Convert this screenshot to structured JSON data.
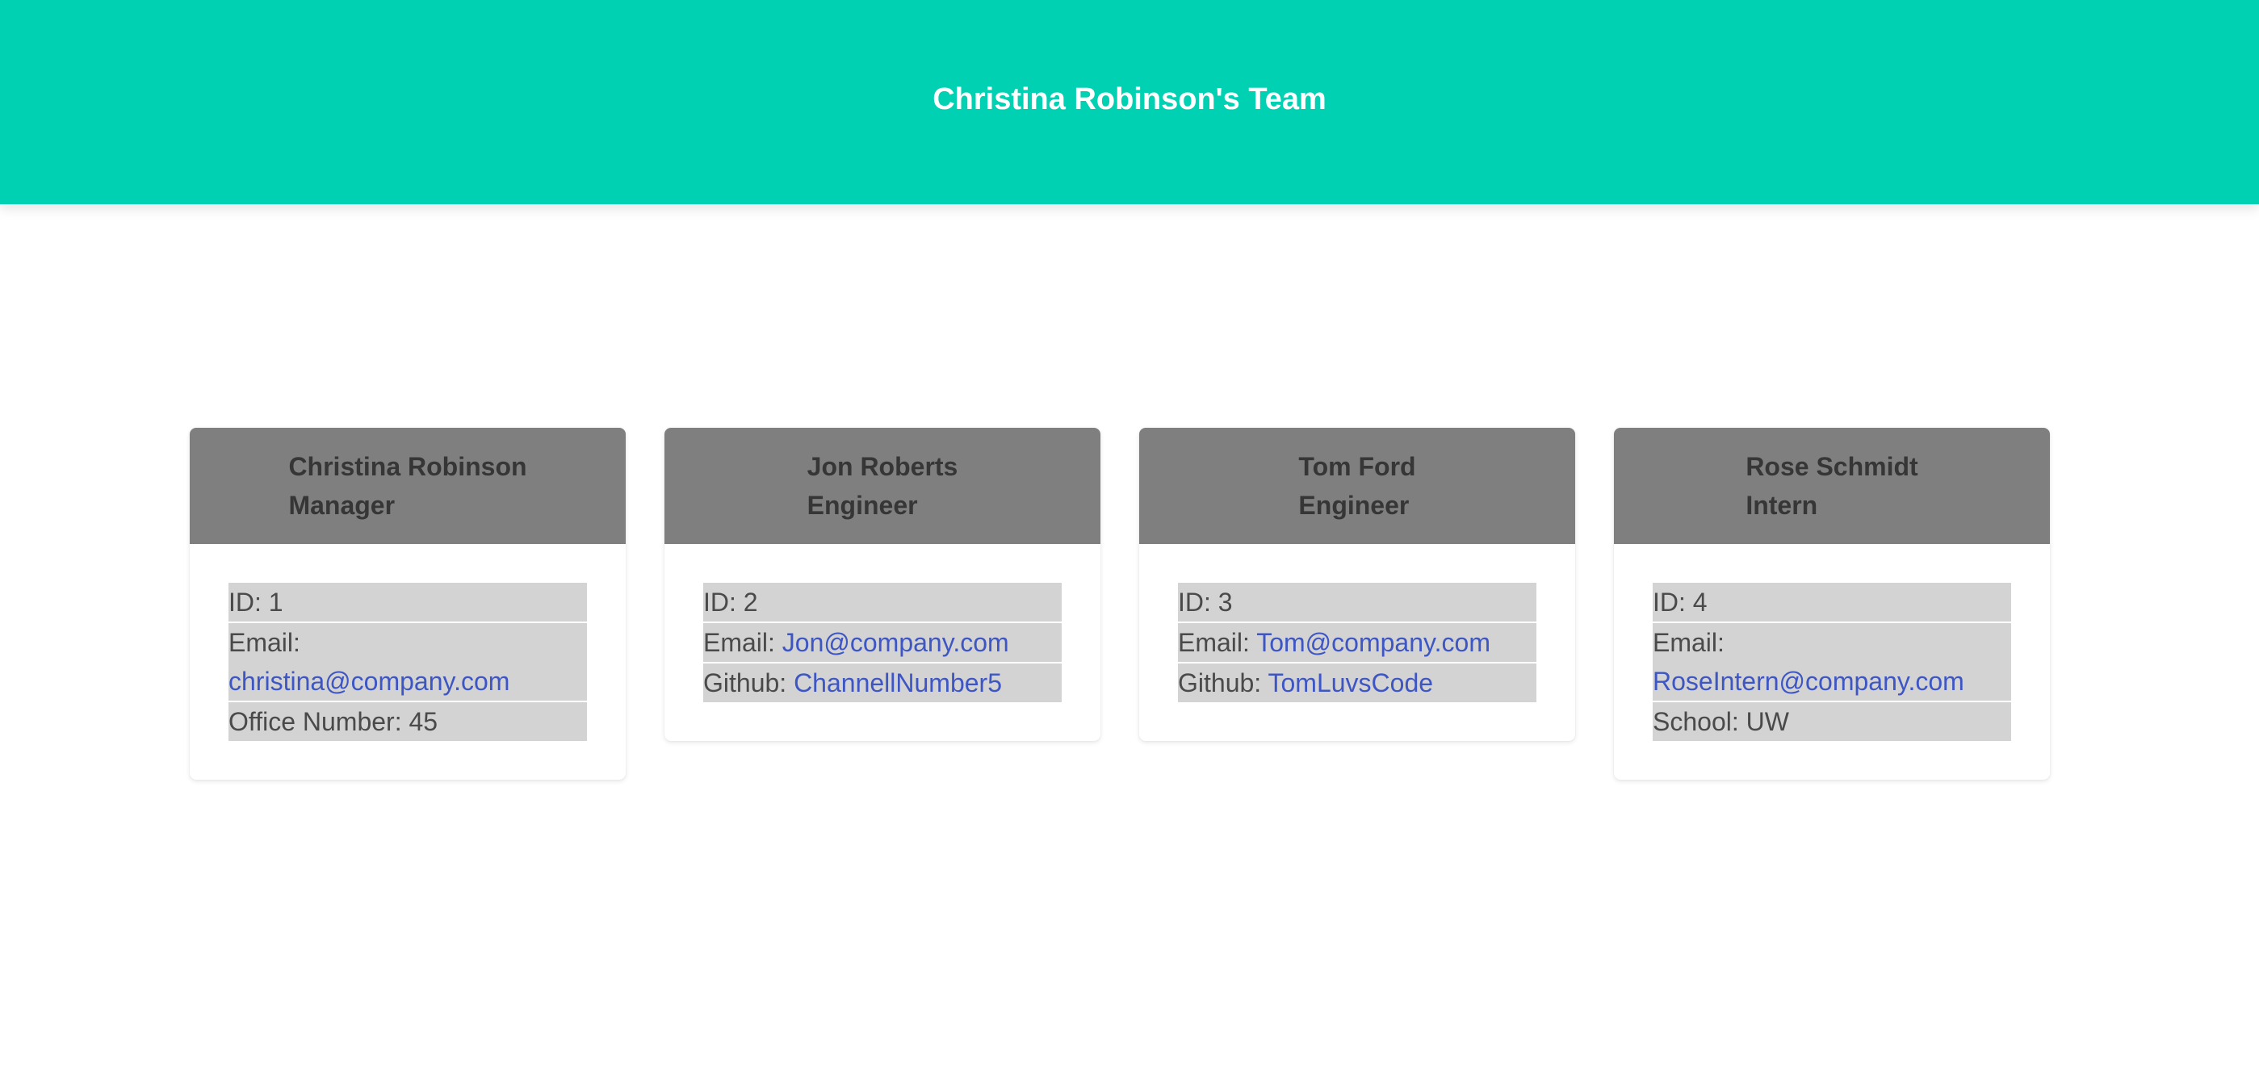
{
  "header": {
    "title": "Christina Robinson's Team"
  },
  "colors": {
    "banner": "#00d1b2",
    "card_header": "#7f7f7f",
    "row_background": "#d3d3d3",
    "link": "#3e56c4"
  },
  "cards": [
    {
      "name": "Christina Robinson",
      "role": "Manager",
      "id_label": "ID: 1",
      "email_label": "Email:",
      "email": "christina@company.com",
      "extra_label": "Office Number: 45",
      "extra_link": ""
    },
    {
      "name": "Jon Roberts",
      "role": "Engineer",
      "id_label": "ID: 2",
      "email_label": "Email:",
      "email": "Jon@company.com",
      "extra_label": "Github:",
      "extra_link": "ChannellNumber5"
    },
    {
      "name": "Tom Ford",
      "role": "Engineer",
      "id_label": "ID: 3",
      "email_label": "Email:",
      "email": "Tom@company.com",
      "extra_label": "Github:",
      "extra_link": "TomLuvsCode"
    },
    {
      "name": "Rose Schmidt",
      "role": "Intern",
      "id_label": "ID: 4",
      "email_label": "Email:",
      "email": "RoseIntern@company.com",
      "extra_label": "School: UW",
      "extra_link": ""
    }
  ]
}
